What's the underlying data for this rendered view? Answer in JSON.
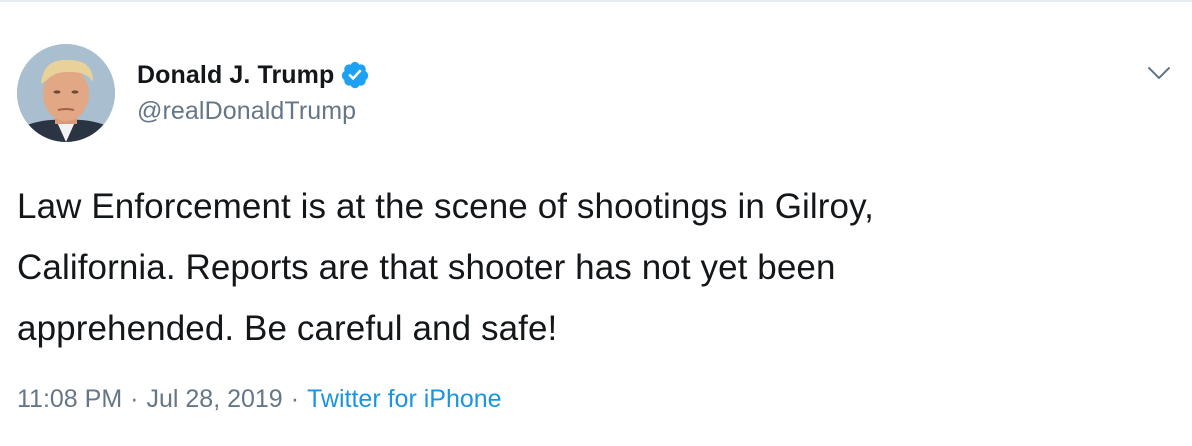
{
  "tweet": {
    "author": {
      "display_name": "Donald J. Trump",
      "handle": "@realDonaldTrump",
      "verified": true
    },
    "text_lines": [
      "Law Enforcement is at the scene of shootings in Gilroy,",
      "California. Reports are that shooter has not yet been",
      "apprehended. Be careful and safe!"
    ],
    "time": "11:08 PM",
    "separator": "·",
    "date": "Jul 28, 2019",
    "source": "Twitter for iPhone"
  },
  "icons": {
    "verified": "verified-badge-icon",
    "menu": "chevron-down-icon"
  },
  "colors": {
    "primary_text": "#14171a",
    "secondary_text": "#657786",
    "link": "#1b95e0",
    "verified_badge": "#1da1f2",
    "divider": "#e6ecf0"
  }
}
